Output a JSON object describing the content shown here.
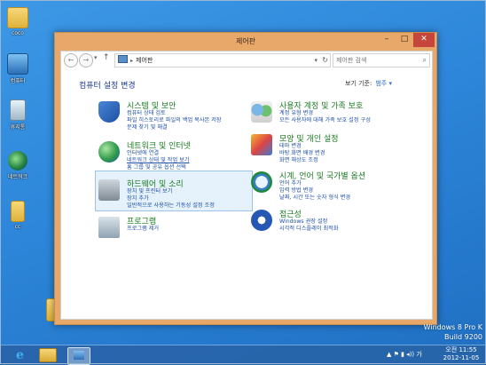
{
  "desktop": {
    "icons": [
      {
        "label": "coco"
      },
      {
        "label": "컴퓨터"
      },
      {
        "label": "휴지통"
      },
      {
        "label": "네트워크"
      },
      {
        "label": "cc"
      }
    ]
  },
  "window": {
    "title": "제어판",
    "controls": {
      "minimize": "–",
      "maximize": "□",
      "close": "✕"
    },
    "nav": {
      "back": "←",
      "forward": "→",
      "dropdown": "▾",
      "up": "↑"
    },
    "address": {
      "separator": "▸",
      "path": "제어판",
      "dropdown": "▾",
      "refresh": "↻"
    },
    "search": {
      "placeholder": "제어판 검색",
      "icon": "⌕"
    },
    "heading": "컴퓨터 설정 변경",
    "view_by": {
      "label": "보기 기준:",
      "value": "범주 ▾"
    },
    "categories": [
      {
        "icon": "shield-icon",
        "title": "시스템 및 보안",
        "links": [
          "컴퓨터 상태 검토",
          "파일 히스토리로 파일의 백업 복사본 저장",
          "문제 찾기 및 해결"
        ]
      },
      {
        "icon": "network-icon",
        "title": "네트워크 및 인터넷",
        "links": [
          "인터넷에 연결",
          "네트워크 상태 및 작업 보기",
          "홈 그룹 및 공유 옵션 선택"
        ]
      },
      {
        "icon": "hardware-icon",
        "title": "하드웨어 및 소리",
        "links": [
          "장치 및 프린터 보기",
          "장치 추가",
          "일반적으로 사용하는 기동성 설정 조정"
        ]
      },
      {
        "icon": "programs-icon",
        "title": "프로그램",
        "links": [
          "프로그램 제거"
        ]
      },
      {
        "icon": "users-icon",
        "title": "사용자 계정 및 가족 보호",
        "links": [
          "계정 유형 변경",
          "모든 사용자에 대해 가족 보호 설정 구성"
        ]
      },
      {
        "icon": "appearance-icon",
        "title": "모양 및 개인 설정",
        "links": [
          "테마 변경",
          "바탕 화면 배경 변경",
          "화면 해상도 조정"
        ]
      },
      {
        "icon": "clock-icon",
        "title": "시계, 언어 및 국가별 옵션",
        "links": [
          "언어 추가",
          "입력 방법 변경",
          "날짜, 시간 또는 숫자 형식 변경"
        ]
      },
      {
        "icon": "accessibility-icon",
        "title": "접근성",
        "links": [
          "Windows 권장 설정",
          "시각적 디스플레이 최적화"
        ]
      }
    ]
  },
  "watermark": {
    "line1": "Windows 8 Pro K",
    "line2": "Build 9200"
  },
  "taskbar": {
    "ie_glyph": "e",
    "tray_icons": "▲ ⚑ ▮ ◂)) 가",
    "time": "오전 11:55",
    "date": "2012-11-05"
  }
}
